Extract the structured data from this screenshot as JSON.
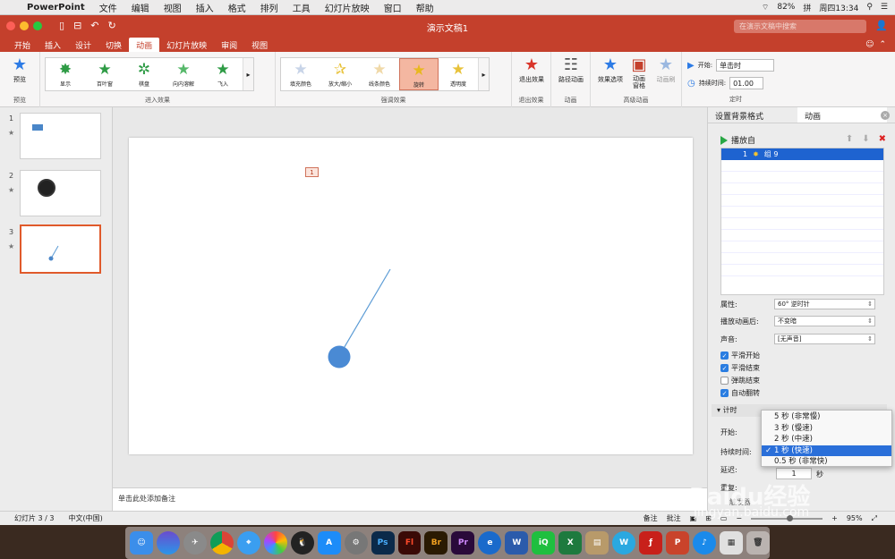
{
  "menubar": {
    "app": "PowerPoint",
    "items": [
      "文件",
      "编辑",
      "视图",
      "插入",
      "格式",
      "排列",
      "工具",
      "幻灯片放映",
      "窗口",
      "帮助"
    ],
    "battery": "82%",
    "input_method": "拼",
    "clock": "周四13:34"
  },
  "window": {
    "title": "演示文稿1",
    "search_placeholder": "在演示文稿中搜索"
  },
  "tabs": [
    "开始",
    "插入",
    "设计",
    "切换",
    "动画",
    "幻灯片放映",
    "审阅",
    "视图"
  ],
  "active_tab": "动画",
  "ribbon": {
    "preview_label": "预览",
    "preview_group": "预览",
    "entrance_group": "进入效果",
    "entrance_items": [
      "显示",
      "百叶窗",
      "棋盘",
      "向内溶解",
      "飞入"
    ],
    "emphasis_group": "强调效果",
    "emphasis_items": [
      "填充颜色",
      "放大/缩小",
      "线条颜色",
      "旋转",
      "透明度"
    ],
    "exit_label": "退出效果",
    "exit_group": "退出效果",
    "path_label": "路径动画",
    "path_group": "动画",
    "options_label": "效果选项",
    "pane_label": "动画\n窗格",
    "painter_label": "动画刷",
    "advanced_group": "高级动画",
    "start_label": "开始:",
    "start_value": "单击时",
    "duration_label": "持续时间:",
    "duration_value": "01.00",
    "timing_group": "定时"
  },
  "slides": [
    {
      "num": "1",
      "star": "★"
    },
    {
      "num": "2",
      "star": "★"
    },
    {
      "num": "3",
      "star": "★"
    }
  ],
  "slide_tag": "1",
  "notes_placeholder": "单击此处添加备注",
  "right_panel": {
    "tab_bg": "设置背景格式",
    "tab_anim": "动画",
    "play_from": "播放自",
    "item_num": "1",
    "item_name": "组 9",
    "property_label": "属性:",
    "property_value": "60° 逆时针",
    "after_label": "播放动画后:",
    "after_value": "不变暗",
    "sound_label": "声音:",
    "sound_value": "[无声音]",
    "checks": [
      {
        "label": "平滑开始",
        "on": true
      },
      {
        "label": "平滑结束",
        "on": true
      },
      {
        "label": "弹跳结束",
        "on": false
      },
      {
        "label": "自动翻转",
        "on": true
      }
    ],
    "timing_section": "计时",
    "t_start_label": "开始:",
    "t_duration_label": "持续时间:",
    "t_delay_label": "延迟:",
    "t_repeat_label": "重复:",
    "delay_value": "1",
    "delay_unit": "秒",
    "triggers_label": "触发器"
  },
  "duration_options": [
    "5 秒 (非常慢)",
    "3 秒 (慢速)",
    "2 秒 (中速)",
    "1 秒 (快速)",
    "0.5 秒 (非常快)"
  ],
  "duration_selected": "1 秒 (快速)",
  "status": {
    "slide": "幻灯片 3 / 3",
    "lang": "中文(中国)",
    "notes": "备注",
    "comments": "批注",
    "zoom": "95%"
  },
  "watermark": "Baidu经验",
  "watermark_url": "jingyan.baidu.com",
  "dock_icons": [
    "finder-icon",
    "siri-icon",
    "launchpad-icon",
    "chrome-icon",
    "safari-icon",
    "photos-icon",
    "qq-icon",
    "appstore-icon",
    "settings-icon",
    "photoshop-icon",
    "flash-icon",
    "bridge-icon",
    "premiere-icon",
    "browser-icon",
    "word-icon",
    "iqiyi-icon",
    "excel-icon",
    "archive-icon",
    "wps-icon",
    "flashplayer-icon",
    "powerpoint-icon",
    "music-icon",
    "preview-icon",
    "trash-icon"
  ],
  "colors": {
    "accent": "#c4402c",
    "selected": "#1e63d0",
    "shape": "#5b9bd5"
  }
}
